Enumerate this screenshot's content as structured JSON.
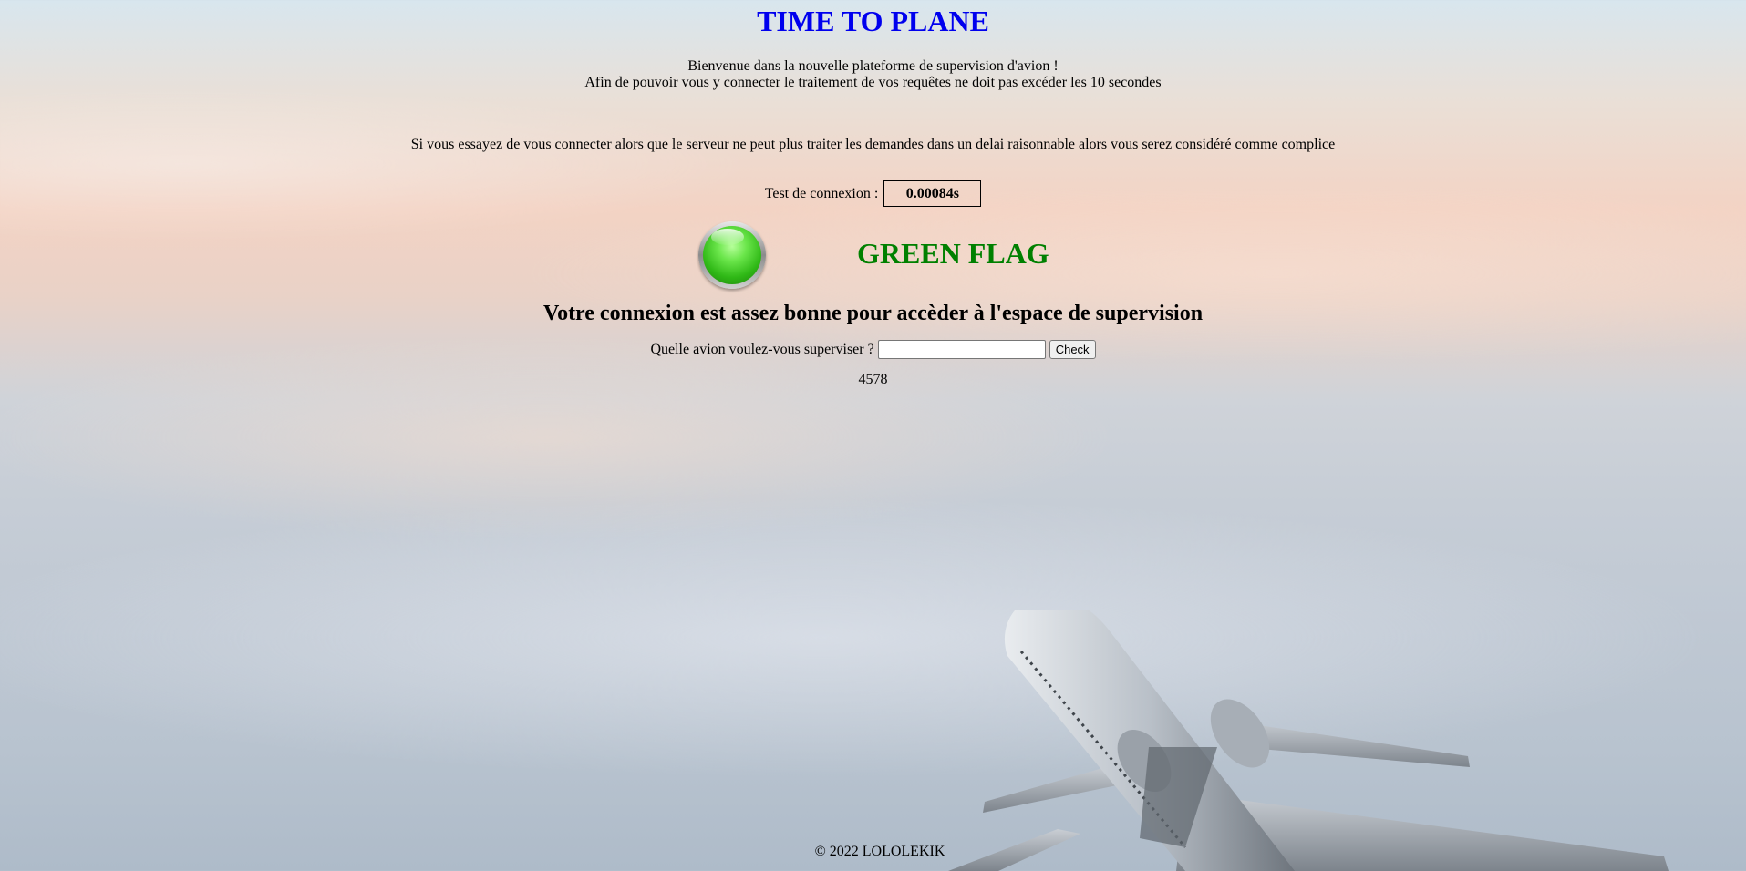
{
  "page": {
    "title": "TIME TO PLANE",
    "intro_line1": "Bienvenue dans la nouvelle plateforme de supervision d'avion !",
    "intro_line2": "Afin de pouvoir vous y connecter le traitement de vos requêtes ne doit pas excéder les 10 secondes",
    "warning": "Si vous essayez de vous connecter alors que le serveur ne peut plus traiter les demandes dans un delai raisonnable alors vous serez considéré comme complice"
  },
  "connection_test": {
    "label": "Test de connexion :",
    "value": "0.00084s"
  },
  "flag": {
    "status_icon": "green-led-icon",
    "color": "#008000",
    "label": "GREEN FLAG"
  },
  "status_message": "Votre connexion est assez bonne pour accèder à l'espace de supervision",
  "form": {
    "label": "Quelle avion voulez-vous superviser ?",
    "input_value": "",
    "button_label": "Check"
  },
  "result": "4578",
  "footer": "© 2022 LOLOLEKIK",
  "colors": {
    "title": "#0000ee",
    "flag": "#008000"
  }
}
